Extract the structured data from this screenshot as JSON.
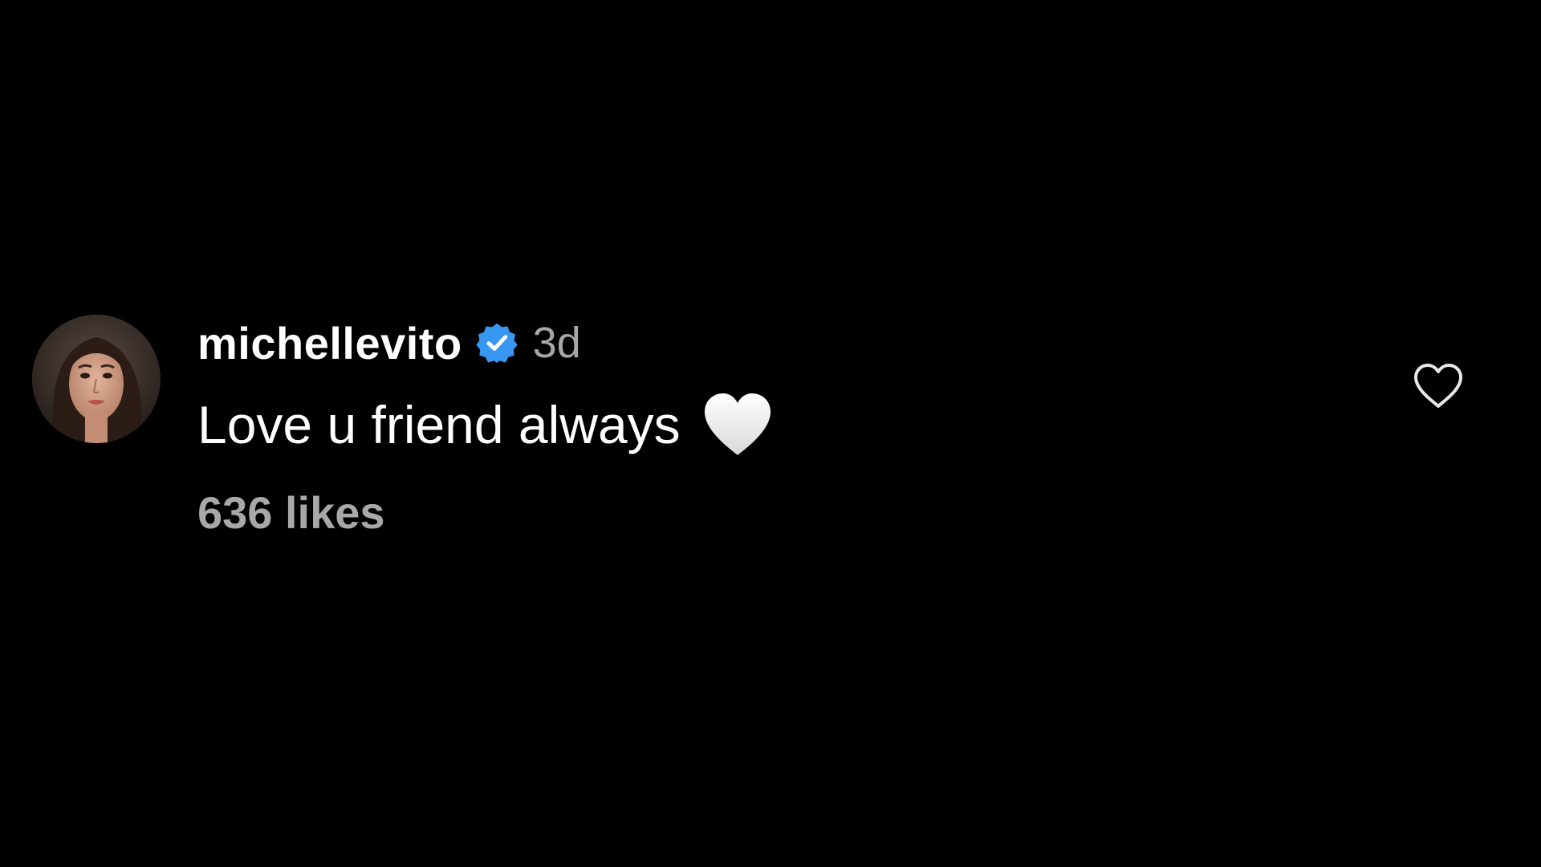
{
  "comment": {
    "username": "michellevito",
    "verified_icon": "verified-badge-icon",
    "timestamp": "3d",
    "text": "Love u friend always",
    "emoji": "white-heart-emoji",
    "likes": "636 likes",
    "like_icon": "heart-outline-icon"
  },
  "colors": {
    "background": "#000000",
    "text": "#ffffff",
    "secondary_text": "#a8a8a8",
    "verified_blue": "#3897f0"
  }
}
